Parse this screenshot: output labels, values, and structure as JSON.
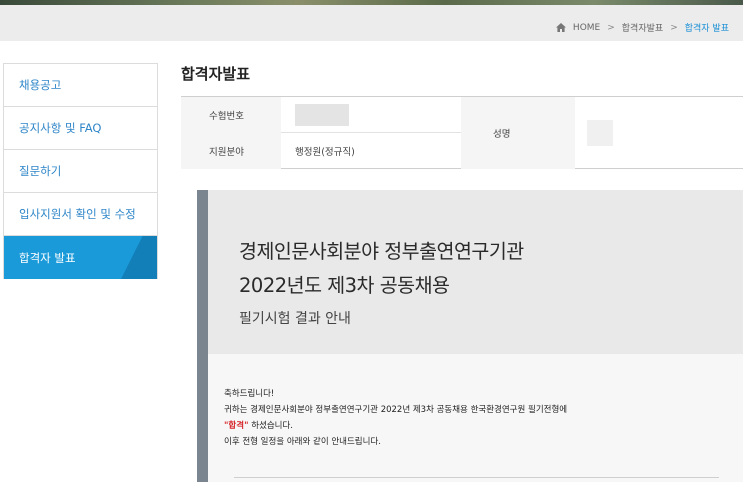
{
  "breadcrumb": {
    "home": "HOME",
    "items": [
      "합격자발표",
      "합격자 발표"
    ],
    "separator": ">"
  },
  "sidebar": {
    "items": [
      {
        "label": "채용공고"
      },
      {
        "label": "공지사항 및 FAQ"
      },
      {
        "label": "질문하기"
      },
      {
        "label": "입사지원서 확인 및 수정"
      },
      {
        "label": "합격자 발표",
        "active": true
      }
    ]
  },
  "page": {
    "title": "합격자발표"
  },
  "info": {
    "exam_number_label": "수험번호",
    "field_label": "지원분야",
    "field_value": "행정원(정규직)",
    "name_label": "성명"
  },
  "notice": {
    "line1": "경제인문사회분야 정부출연연구기관",
    "line2": "2022년도 제3차 공동채용",
    "subtitle": "필기시험 결과 안내",
    "congrats": "축하드립니다!",
    "body1": "귀하는 경제인문사회분야 정부출연연구기관 2022년 제3차 공동채용 한국환경연구원 필기전형에",
    "pass_word": "\"합격\"",
    "body2_suffix": " 하셨습니다.",
    "body3": "이후 전형 일정을 아래와 같이 안내드립니다."
  },
  "colors": {
    "accent": "#1a9ad9",
    "link": "#2f86c8",
    "pass": "#d6262b"
  }
}
